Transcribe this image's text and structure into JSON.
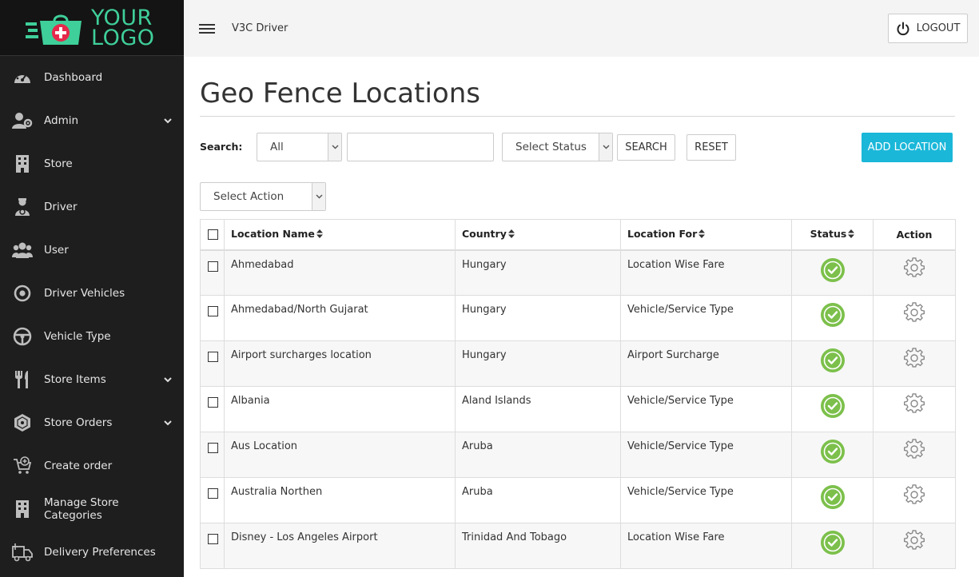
{
  "brand": {
    "logo_line1": "YOUR",
    "logo_line2": "LOGO",
    "logo_color": "#3fcf9a"
  },
  "topbar": {
    "title": "V3C  Driver",
    "logout_label": "LOGOUT"
  },
  "sidebar": {
    "items": [
      {
        "label": "Dashboard",
        "icon": "dashboard-icon",
        "expandable": false
      },
      {
        "label": "Admin",
        "icon": "admin-icon",
        "expandable": true
      },
      {
        "label": "Store",
        "icon": "store-building-icon",
        "expandable": false
      },
      {
        "label": "Driver",
        "icon": "driver-icon",
        "expandable": false
      },
      {
        "label": "User",
        "icon": "users-icon",
        "expandable": false
      },
      {
        "label": "Driver Vehicles",
        "icon": "target-icon",
        "expandable": false
      },
      {
        "label": "Vehicle Type",
        "icon": "steering-wheel-icon",
        "expandable": false
      },
      {
        "label": "Store Items",
        "icon": "fork-knife-icon",
        "expandable": true
      },
      {
        "label": "Store Orders",
        "icon": "orders-icon",
        "expandable": true
      },
      {
        "label": "Create order",
        "icon": "cart-plus-icon",
        "expandable": false
      },
      {
        "label": "Manage Store Categories",
        "icon": "categories-building-icon",
        "expandable": false
      },
      {
        "label": "Delivery Preferences",
        "icon": "delivery-truck-icon",
        "expandable": false
      }
    ]
  },
  "page": {
    "title": "Geo Fence Locations"
  },
  "filters": {
    "search_label": "Search:",
    "field_select_value": "All",
    "search_input_value": "",
    "status_select_value": "Select Status",
    "search_button": "SEARCH",
    "reset_button": "RESET",
    "add_button": "ADD LOCATION",
    "action_select_value": "Select Action"
  },
  "table": {
    "headers": {
      "name": "Location Name",
      "country": "Country",
      "location_for": "Location For",
      "status": "Status",
      "action": "Action"
    },
    "rows": [
      {
        "name": "Ahmedabad",
        "country": "Hungary",
        "location_for": "Location Wise Fare",
        "status": "active"
      },
      {
        "name": "Ahmedabad/North Gujarat",
        "country": "Hungary",
        "location_for": "Vehicle/Service Type",
        "status": "active"
      },
      {
        "name": "Airport surcharges location",
        "country": "Hungary",
        "location_for": "Airport Surcharge",
        "status": "active"
      },
      {
        "name": "Albania",
        "country": "Aland Islands",
        "location_for": "Vehicle/Service Type",
        "status": "active"
      },
      {
        "name": "Aus Location",
        "country": "Aruba",
        "location_for": "Vehicle/Service Type",
        "status": "active"
      },
      {
        "name": "Australia Northen",
        "country": "Aruba",
        "location_for": "Vehicle/Service Type",
        "status": "active"
      },
      {
        "name": "Disney - Los Angeles Airport",
        "country": "Trinidad And Tobago",
        "location_for": "Location Wise Fare",
        "status": "active"
      }
    ]
  },
  "colors": {
    "sidebar_bg": "#1e1e1e",
    "accent": "#1ab7d9",
    "status_active": "#7cc04b"
  }
}
